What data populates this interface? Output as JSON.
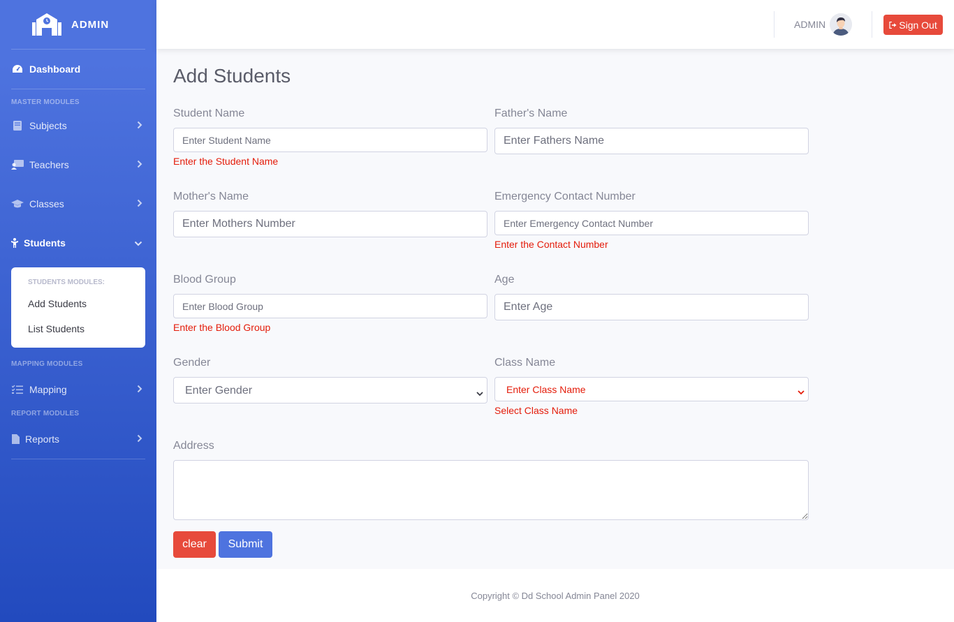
{
  "brand": {
    "name": "ADMIN"
  },
  "sidebar": {
    "dashboard": "Dashboard",
    "sections": {
      "master": "MASTER MODULES",
      "mapping": "MAPPING MODULES",
      "report": "REPORT MODULES"
    },
    "items": {
      "subjects": "Subjects",
      "teachers": "Teachers",
      "classes": "Classes",
      "students": "Students",
      "mapping": "Mapping",
      "reports": "Reports"
    },
    "students_submenu": {
      "heading": "STUDENTS MODULES:",
      "add": "Add Students",
      "list": "List Students"
    }
  },
  "topbar": {
    "user": "ADMIN",
    "signout": "Sign Out"
  },
  "form": {
    "title": "Add Students",
    "student_name": {
      "label": "Student Name",
      "placeholder": "Enter Student Name",
      "error": "Enter the Student Name"
    },
    "father_name": {
      "label": "Father's Name",
      "placeholder": "Enter Fathers Name"
    },
    "mother_name": {
      "label": "Mother's Name",
      "placeholder": "Enter Mothers Number"
    },
    "emergency": {
      "label": "Emergency Contact Number",
      "placeholder": "Enter Emergency Contact Number",
      "error": "Enter the Contact Number"
    },
    "blood_group": {
      "label": "Blood Group",
      "placeholder": "Enter Blood Group",
      "error": "Enter the Blood Group"
    },
    "age": {
      "label": "Age",
      "placeholder": "Enter Age"
    },
    "gender": {
      "label": "Gender",
      "selected": "Enter Gender"
    },
    "class_name": {
      "label": "Class Name",
      "selected": "Enter Class Name",
      "error": "Select Class Name"
    },
    "address": {
      "label": "Address",
      "value": ""
    },
    "clear_label": "clear",
    "submit_label": "Submit"
  },
  "footer": {
    "text": "Copyright © Dd School Admin Panel 2020"
  },
  "colors": {
    "primary": "#4e73df",
    "danger": "#e74a3b",
    "error_text": "#e41c0a"
  }
}
